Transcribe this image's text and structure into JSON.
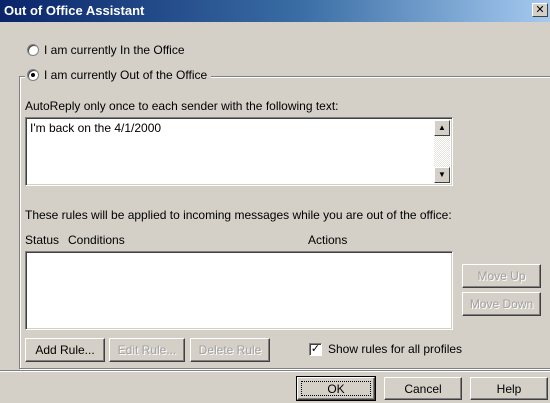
{
  "window": {
    "title": "Out of Office Assistant",
    "close_glyph": "✕"
  },
  "status": {
    "in_office_label": "I am currently In the Office",
    "out_office_label": "I am currently Out of the Office",
    "selected": "out"
  },
  "autoreply": {
    "label": "AutoReply only once to each sender with the following text:",
    "text": "I'm back on the 4/1/2000"
  },
  "rules": {
    "description": "These rules will be applied to incoming messages while you are out of the office:",
    "columns": [
      "Status",
      "Conditions",
      "Actions"
    ],
    "rows": []
  },
  "buttons": {
    "move_up": "Move Up",
    "move_down": "Move Down",
    "add_rule": "Add Rule...",
    "edit_rule": "Edit Rule...",
    "delete_rule": "Delete Rule",
    "ok": "OK",
    "cancel": "Cancel",
    "help": "Help"
  },
  "show_all_profiles": {
    "label": "Show rules for all profiles",
    "checked": true,
    "check_glyph": "✓"
  },
  "icons": {
    "scroll_up": "▲",
    "scroll_down": "▼"
  }
}
